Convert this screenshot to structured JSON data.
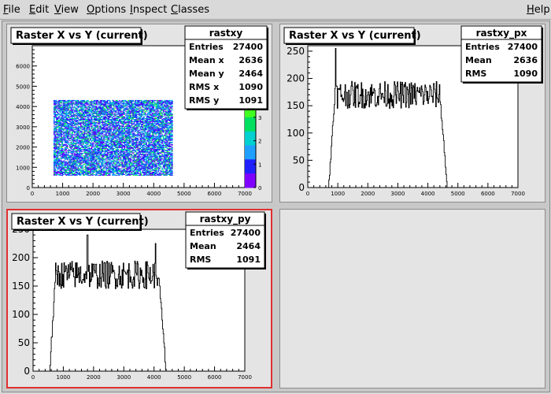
{
  "menu": {
    "items": [
      {
        "key": "F",
        "rest": "ile"
      },
      {
        "key": "E",
        "rest": "dit"
      },
      {
        "key": "V",
        "rest": "iew"
      },
      {
        "key": "O",
        "rest": "ptions"
      },
      {
        "key": "I",
        "rest": "nspect"
      },
      {
        "key": "C",
        "rest": "lasses"
      }
    ],
    "help": {
      "key": "H",
      "rest": "elp"
    }
  },
  "pads": [
    {
      "title": "Raster X vs Y (current)",
      "stats_name": "rastxy",
      "stats": [
        [
          "Entries",
          "27400"
        ],
        [
          "Mean x",
          "2636"
        ],
        [
          "Mean y",
          "2464"
        ],
        [
          "RMS x",
          "1090"
        ],
        [
          "RMS y",
          "1091"
        ]
      ]
    },
    {
      "title": "Raster X vs Y (current)",
      "stats_name": "rastxy_px",
      "stats": [
        [
          "Entries",
          "27400"
        ],
        [
          "Mean",
          "2636"
        ],
        [
          "RMS",
          "1090"
        ]
      ]
    },
    {
      "title": "Raster X vs Y (current)",
      "stats_name": "rastxy_py",
      "stats": [
        [
          "Entries",
          "27400"
        ],
        [
          "Mean",
          "2464"
        ],
        [
          "RMS",
          "1091"
        ]
      ]
    }
  ],
  "chart_data": [
    {
      "type": "heatmap",
      "name": "rastxy",
      "x_range": [
        0,
        7000
      ],
      "y_range": [
        0,
        7000
      ],
      "x_ticks": [
        0,
        1000,
        2000,
        3000,
        4000,
        5000,
        6000,
        7000
      ],
      "y_ticks": [
        0,
        1000,
        2000,
        3000,
        4000,
        5000,
        6000
      ],
      "filled_x": [
        700,
        4600
      ],
      "filled_y": [
        600,
        4300
      ],
      "z_palette_ticks": [
        0,
        1,
        2,
        3
      ],
      "palette": [
        "#ffffff",
        "#7f00ff",
        "#2020ff",
        "#1fa0ff",
        "#00d0d0",
        "#00e060",
        "#40ff20"
      ]
    },
    {
      "type": "line",
      "name": "rastxy_px",
      "x_range": [
        0,
        7000
      ],
      "y_range": [
        0,
        260
      ],
      "x_ticks": [
        0,
        1000,
        2000,
        3000,
        4000,
        5000,
        6000,
        7000
      ],
      "y_ticks": [
        0,
        50,
        100,
        150,
        200,
        250
      ],
      "rise": [
        700,
        900
      ],
      "plateau": [
        900,
        4400
      ],
      "fall": [
        4400,
        4650
      ],
      "level": 170,
      "noise": 25,
      "spikes": [
        [
          930,
          255
        ]
      ]
    },
    {
      "type": "line",
      "name": "rastxy_py",
      "x_range": [
        0,
        7000
      ],
      "y_range": [
        0,
        250
      ],
      "x_ticks": [
        0,
        1000,
        2000,
        3000,
        4000,
        5000,
        6000,
        7000
      ],
      "y_ticks": [
        0,
        50,
        100,
        150,
        200,
        250
      ],
      "rise": [
        550,
        750
      ],
      "plateau": [
        750,
        4150
      ],
      "fall": [
        4150,
        4400
      ],
      "level": 170,
      "noise": 25,
      "spikes": [
        [
          1800,
          240
        ],
        [
          4050,
          225
        ]
      ]
    }
  ]
}
